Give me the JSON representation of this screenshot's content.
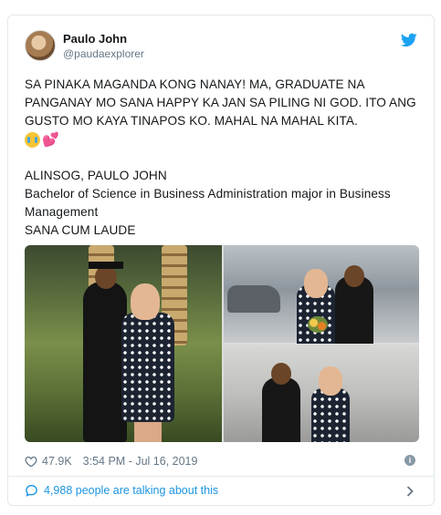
{
  "author": {
    "name": "Paulo John",
    "handle": "@paudaexplorer"
  },
  "tweet": {
    "line1": "SA PINAKA MAGANDA KONG NANAY! MA, GRADUATE NA PANGANAY MO SANA HAPPY KA JAN SA PILING NI GOD. ITO ANG GUSTO MO KAYA TINAPOS KO. MAHAL NA MAHAL KITA.",
    "emoji_heart": "💕",
    "name_line": "ALINSOG, PAULO JOHN",
    "degree_line": "Bachelor of Science in Business Administration major in Business Management",
    "honor_line": "SANA CUM LAUDE"
  },
  "meta": {
    "likes": "47.9K",
    "timestamp": "3:54 PM - Jul 16, 2019"
  },
  "footer": {
    "talking": "4,988 people are talking about this"
  },
  "icons": {
    "twitter_bird": "twitter-bird-icon",
    "like": "heart-icon",
    "info": "info-icon",
    "reply": "speech-bubble-icon",
    "more": "chevron-right-icon"
  },
  "colors": {
    "brand": "#1da1f2",
    "link": "#1b95e0",
    "muted": "#657786",
    "border": "#e1e8ed"
  }
}
